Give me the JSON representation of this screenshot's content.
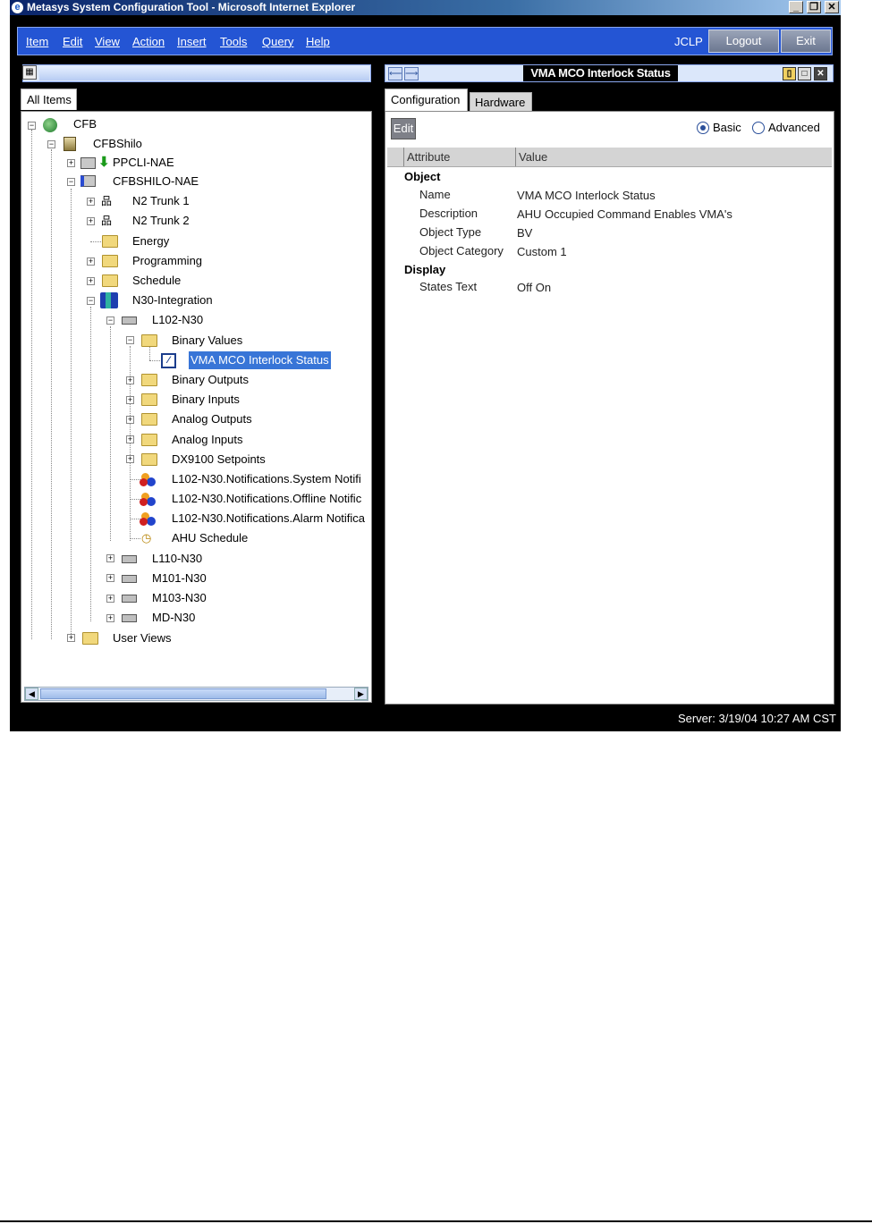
{
  "window": {
    "title": "Metasys System Configuration Tool - Microsoft Internet Explorer",
    "min": "_",
    "restore": "❐",
    "close": "✕"
  },
  "menubar": {
    "items": [
      "Item",
      "Edit",
      "View",
      "Action",
      "Insert",
      "Tools",
      "Query",
      "Help"
    ],
    "user": "JCLP",
    "logout": "Logout",
    "exit": "Exit"
  },
  "left": {
    "tab": "All Items",
    "tree": {
      "root": "CFB",
      "site": "CFBShilo",
      "ppcli": "PPCLI-NAE",
      "nae": "CFBSHILO-NAE",
      "n2trunk1": "N2 Trunk 1",
      "n2trunk2": "N2 Trunk 2",
      "energy": "Energy",
      "programming": "Programming",
      "schedule": "Schedule",
      "n30": "N30-Integration",
      "l102": "L102-N30",
      "binvalues": "Binary Values",
      "vma": "VMA MCO Interlock Status",
      "binoutputs": "Binary Outputs",
      "bininputs": "Binary Inputs",
      "anaoutputs": "Analog Outputs",
      "anainputs": "Analog Inputs",
      "dx9100": "DX9100 Setpoints",
      "notif1": "L102-N30.Notifications.System Notifi",
      "notif2": "L102-N30.Notifications.Offline Notific",
      "notif3": "L102-N30.Notifications.Alarm Notifica",
      "ahusched": "AHU Schedule",
      "l110": "L110-N30",
      "m101": "M101-N30",
      "m103": "M103-N30",
      "md": "MD-N30",
      "userviews": "User Views"
    }
  },
  "right": {
    "title": "VMA MCO Interlock Status",
    "tabs": {
      "config": "Configuration",
      "hardware": "Hardware"
    },
    "edit": "Edit",
    "mode": {
      "basic": "Basic",
      "advanced": "Advanced"
    },
    "columns": {
      "attr": "Attribute",
      "value": "Value"
    },
    "sections": {
      "object": "Object",
      "display": "Display"
    },
    "rows": [
      {
        "attr": "Name",
        "value": "VMA MCO Interlock Status"
      },
      {
        "attr": "Description",
        "value": "AHU Occupied Command Enables VMA's"
      },
      {
        "attr": "Object Type",
        "value": "BV"
      },
      {
        "attr": "Object Category",
        "value": "Custom 1"
      },
      {
        "attr": "States Text",
        "value": "Off On"
      }
    ]
  },
  "status": {
    "text": "Server: 3/19/04 10:27 AM CST"
  }
}
